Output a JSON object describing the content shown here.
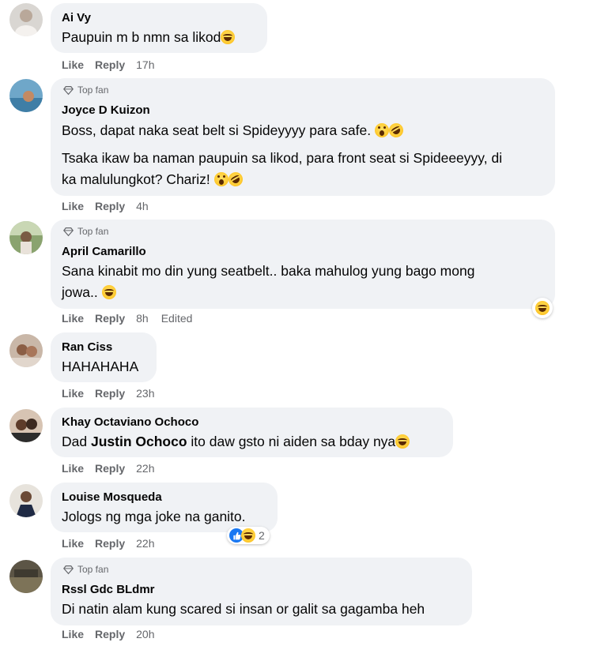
{
  "comments": [
    {
      "author": "Ai Vy",
      "top_fan": "",
      "lines": [
        "Paupuin m b nmn sa likod"
      ],
      "like": "Like",
      "reply": "Reply",
      "time": "17h",
      "edited": ""
    },
    {
      "author": "Joyce D Kuizon",
      "top_fan": "Top fan",
      "lines": [
        "Boss, dapat naka seat belt si Spideyyyy para safe.",
        "Tsaka ikaw ba naman paupuin sa likod, para front seat si Spideeeyyy, di",
        "ka malulungkot? Chariz!"
      ],
      "like": "Like",
      "reply": "Reply",
      "time": "4h",
      "edited": ""
    },
    {
      "author": "April Camarillo",
      "top_fan": "Top fan",
      "lines": [
        "Sana kinabit mo din yung seatbelt.. baka mahulog yung bago mong",
        "jowa.."
      ],
      "like": "Like",
      "reply": "Reply",
      "time": "8h",
      "edited": "Edited"
    },
    {
      "author": "Ran Ciss",
      "top_fan": "",
      "lines": [
        "HAHAHAHA"
      ],
      "like": "Like",
      "reply": "Reply",
      "time": "23h",
      "edited": ""
    },
    {
      "author": "Khay Octaviano Ochoco",
      "top_fan": "",
      "lines": [
        "Dad ",
        "Justin Ochoco",
        " ito daw gsto ni aiden sa bday nya"
      ],
      "like": "Like",
      "reply": "Reply",
      "time": "22h",
      "edited": ""
    },
    {
      "author": "Louise Mosqueda",
      "top_fan": "",
      "lines": [
        "Jologs ng mga joke na ganito."
      ],
      "like": "Like",
      "reply": "Reply",
      "time": "22h",
      "edited": "",
      "reaction_count": "2"
    },
    {
      "author": "Rssl Gdc BLdmr",
      "top_fan": "Top fan",
      "lines": [
        "Di natin alam kung scared si insan or galit sa gagamba heh"
      ],
      "like": "Like",
      "reply": "Reply",
      "time": "20h",
      "edited": ""
    }
  ],
  "colors": {
    "bubble": "#f0f2f5",
    "secondary_text": "#65676b",
    "like_blue": "#1877f2"
  },
  "icons": {
    "top_fan": "diamond-icon",
    "laugh": "laughing-emoji-icon",
    "rofl": "rolling-laughing-emoji-icon",
    "wow": "surprised-emoji-icon",
    "like": "thumbs-up-icon"
  }
}
